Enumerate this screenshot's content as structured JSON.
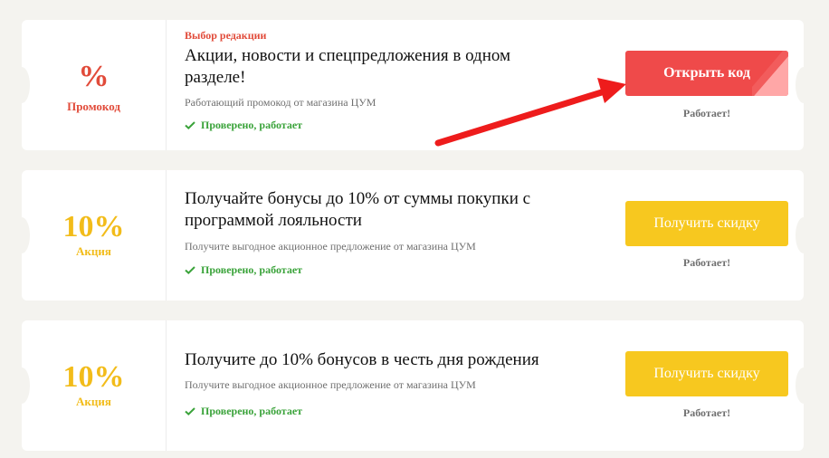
{
  "coupons": [
    {
      "badge_main": "%",
      "badge_sub": "Промокод",
      "editors_choice": "Выбор редакции",
      "title_line1": "Акции, новости и спецпредложения в одном",
      "title_line2": "разделе!",
      "description": "Работающий промокод от магазина ЦУМ",
      "verified": "Проверено, работает",
      "button": "Открыть код",
      "status": "Работает!"
    },
    {
      "badge_main": "10%",
      "badge_sub": "Акция",
      "title_line1": "Получайте бонусы до 10% от суммы покупки с",
      "title_line2": "программой лояльности",
      "description": "Получите выгодное акционное предложение от магазина ЦУМ",
      "verified": "Проверено, работает",
      "button": "Получить скидку",
      "status": "Работает!"
    },
    {
      "badge_main": "10%",
      "badge_sub": "Акция",
      "title_line1": "Получите до 10% бонусов в честь дня рождения",
      "description": "Получите выгодное акционное предложение от магазина ЦУМ",
      "verified": "Проверено, работает",
      "button": "Получить скидку",
      "status": "Работает!"
    }
  ],
  "colors": {
    "promo_red": "#e14b3a",
    "button_red": "#ef4a4a",
    "deal_yellow": "#f7c81f",
    "verified_green": "#3aa33a",
    "arrow_red": "#ee1c1c"
  },
  "icons": {
    "verified": "check-icon",
    "annotation": "red-arrow"
  }
}
